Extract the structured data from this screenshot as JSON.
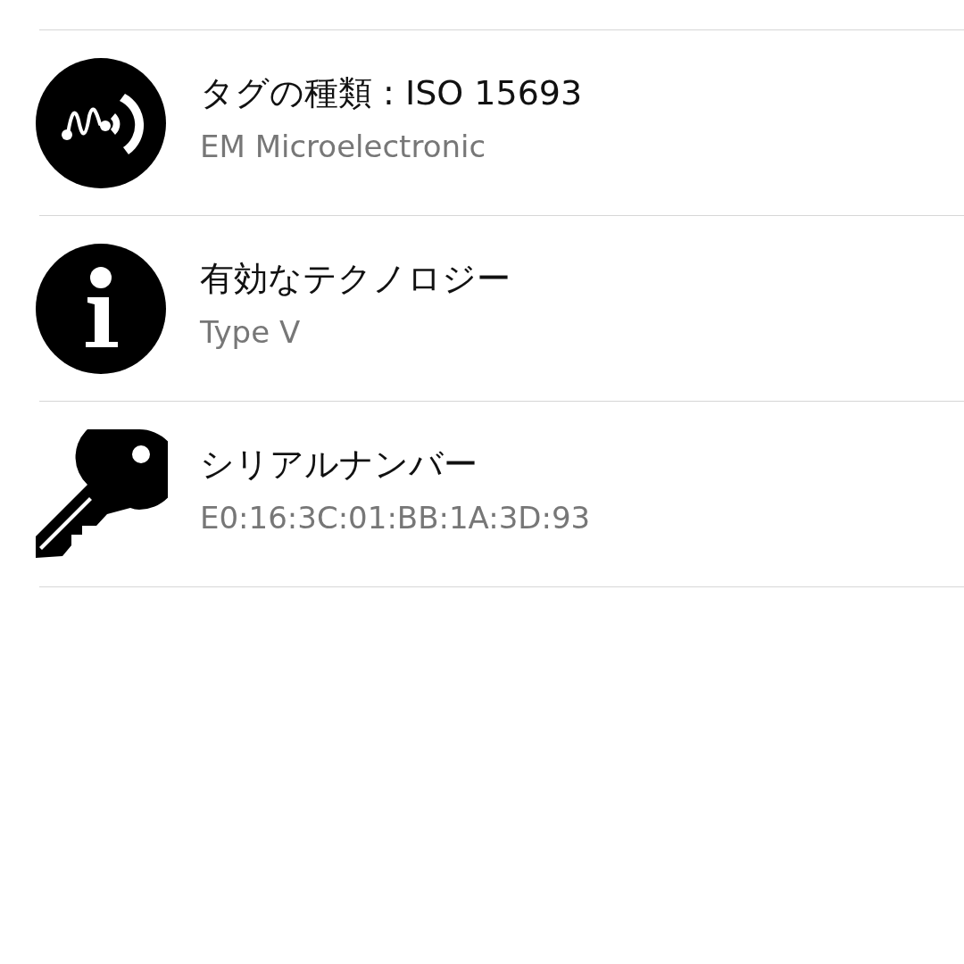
{
  "rows": [
    {
      "kind": "nfc",
      "title": "タグの種類 : ISO 15693",
      "subtitle": "EM Microelectronic"
    },
    {
      "kind": "info",
      "title": "有効なテクノロジー",
      "subtitle": "Type V"
    },
    {
      "kind": "key",
      "title": "シリアルナンバー",
      "subtitle": "E0:16:3C:01:BB:1A:3D:93"
    }
  ]
}
